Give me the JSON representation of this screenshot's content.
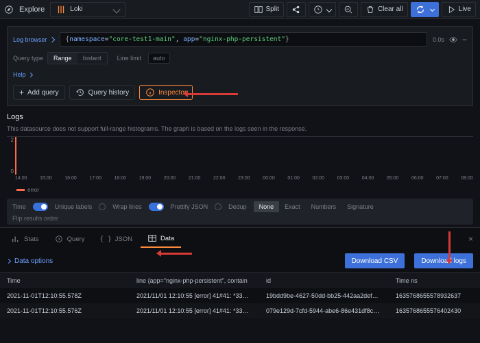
{
  "topbar": {
    "title": "Explore",
    "datasource": "Loki",
    "split": "Split",
    "clear": "Clear all",
    "live": "Live"
  },
  "query": {
    "log_browser": "Log browser",
    "expr": {
      "k1": "namespace",
      "v1": "core-test1-main",
      "k2": "app",
      "v2": "nginx-php-persistent"
    },
    "time": "0.0s",
    "type_label": "Query type",
    "types": {
      "range": "Range",
      "instant": "Instant"
    },
    "line_limit_label": "Line limit",
    "line_limit": "auto",
    "help": "Help"
  },
  "actions": {
    "add": "Add query",
    "history": "Query history",
    "inspector": "Inspector"
  },
  "logs": {
    "title": "Logs",
    "note": "This datasource does not support full-range histograms. The graph is based on the logs seen in the response.",
    "legend": "error"
  },
  "chart_data": {
    "type": "bar",
    "categories": [
      "14:00",
      "15:00",
      "16:00",
      "17:00",
      "18:00",
      "19:00",
      "20:00",
      "21:00",
      "22:00",
      "23:00",
      "00:00",
      "01:00",
      "02:00",
      "03:00",
      "04:00",
      "05:00",
      "06:00",
      "07:00",
      "08:00"
    ],
    "series": [
      {
        "name": "error",
        "values": [
          2,
          0,
          0,
          0,
          0,
          0,
          0,
          0,
          0,
          0,
          0,
          0,
          0,
          0,
          0,
          0,
          0,
          0,
          0
        ]
      }
    ],
    "ylim": [
      0,
      2
    ],
    "yticks": [
      0,
      2
    ]
  },
  "log_opts": {
    "time": "Time",
    "unique": "Unique labels",
    "wrap": "Wrap lines",
    "pretty": "Prettify JSON",
    "dedup": "Dedup",
    "dedup_opts": {
      "none": "None",
      "exact": "Exact",
      "numbers": "Numbers",
      "sig": "Signature"
    },
    "flip": "Flip results order"
  },
  "panel": {
    "tabs": {
      "stats": "Stats",
      "query": "Query",
      "json": "JSON",
      "data": "Data"
    },
    "data_options": "Data options",
    "dl_csv": "Download CSV",
    "dl_logs": "Download logs",
    "headers": {
      "time": "Time",
      "line": "line {app=\"nginx-php-persistent\", contain",
      "id": "id",
      "tns": "Time ns"
    },
    "rows": [
      {
        "time": "2021-11-01T12:10:55.578Z",
        "line": "2021/11/01 12:10:55 [error] 41#41: *33…",
        "id": "19bdd9be-4627-50dd-bb25-442aa2def…",
        "tns": "1635768655578932637"
      },
      {
        "time": "2021-11-01T12:10:55.576Z",
        "line": "2021/11/01 12:10:55 [error] 41#41: *33…",
        "id": "079e129d-7cfd-5944-abe6-86e431df8c…",
        "tns": "1635768655576402430"
      }
    ]
  }
}
